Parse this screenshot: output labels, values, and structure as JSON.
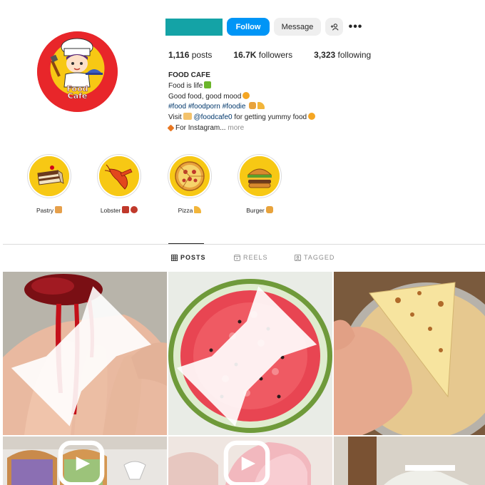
{
  "profile": {
    "follow_label": "Follow",
    "message_label": "Message",
    "more_label": "•••",
    "add_user_label": "+👤",
    "posts_count": "1,116",
    "posts_label": "posts",
    "followers_count": "16.7K",
    "followers_label": "followers",
    "following_count": "3,323",
    "following_label": "following",
    "avatar_text_line1": "Food",
    "avatar_text_line2": "Cafe"
  },
  "bio": {
    "name": "FOOD CAFE",
    "line1": "Food is life",
    "line2": "Good food, good mood",
    "hashtags": [
      "#food",
      "#foodporn",
      "#foodie"
    ],
    "visit_prefix": "Visit",
    "mention": "@foodcafe0",
    "visit_suffix": "for getting yummy food",
    "line5": "For Instagram...",
    "more_label": "more"
  },
  "highlights": [
    {
      "label": "Pastry",
      "icon": "cake-icon"
    },
    {
      "label": "Lobster",
      "icon": "lobster-icon"
    },
    {
      "label": "Pizza",
      "icon": "pizza-icon"
    },
    {
      "label": "Burger",
      "icon": "burger-icon"
    }
  ],
  "tabs": [
    {
      "label": "POSTS",
      "icon": "grid-icon",
      "active": true
    },
    {
      "label": "REELS",
      "icon": "reels-icon",
      "active": false
    },
    {
      "label": "TAGGED",
      "icon": "tagged-icon",
      "active": false
    }
  ],
  "colors": {
    "accent": "#0095f6",
    "username_block": "#14a3a6",
    "avatar_bg": "#e8262a",
    "highlight_bg": "#f7c814"
  }
}
